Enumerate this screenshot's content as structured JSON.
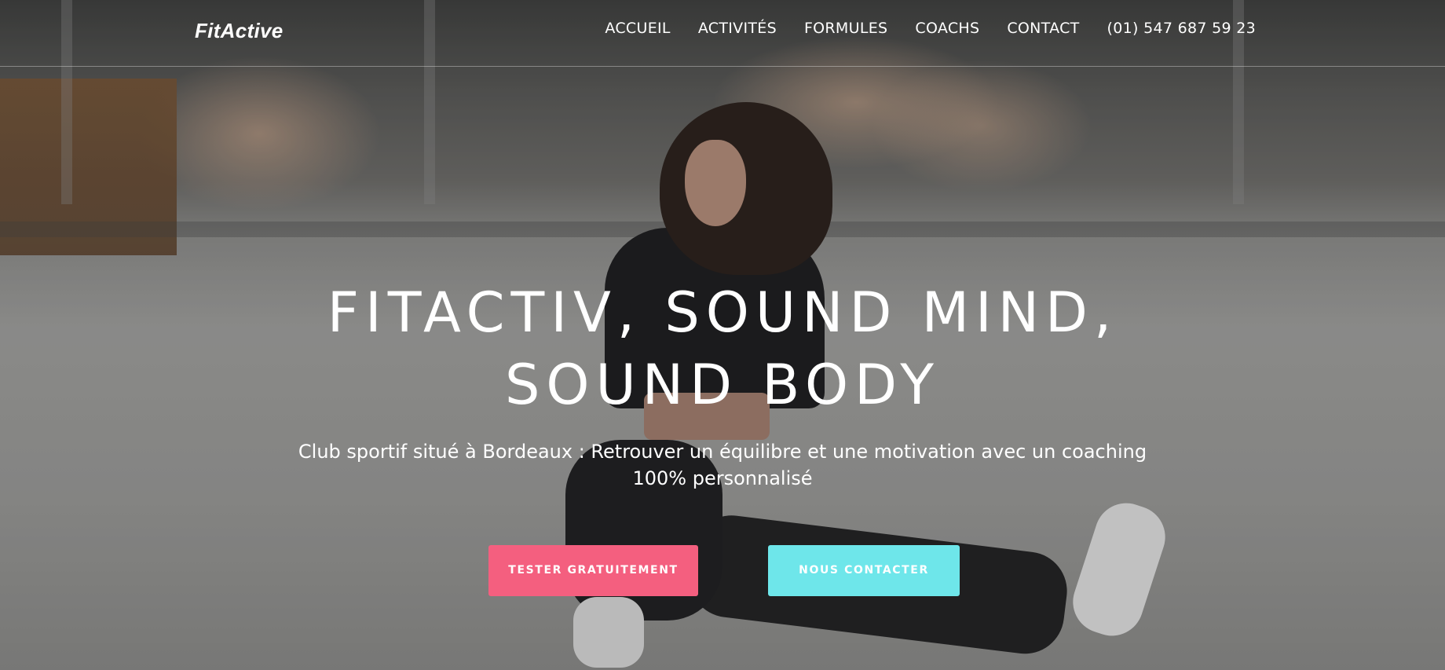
{
  "navbar": {
    "brand": "FitActive",
    "items": [
      {
        "label": "ACCUEIL"
      },
      {
        "label": "ACTIVITÉS"
      },
      {
        "label": "FORMULES"
      },
      {
        "label": "COACHS"
      },
      {
        "label": "CONTACT"
      },
      {
        "label": "(01) 547 687 59 23"
      }
    ]
  },
  "hero": {
    "title_line1": "FITACTIV, SOUND MIND,",
    "title_line2": "SOUND BODY",
    "subtitle_line1": "Club sportif situé à Bordeaux : Retrouver un équilibre et une motivation avec un coaching",
    "subtitle_line2": "100% personnalisé",
    "primary_button": "TESTER GRATUITEMENT",
    "secondary_button": "NOUS CONTACTER"
  },
  "colors": {
    "primary_button": "#f45f7f",
    "secondary_button": "#6ee6ea",
    "text": "#ffffff"
  }
}
